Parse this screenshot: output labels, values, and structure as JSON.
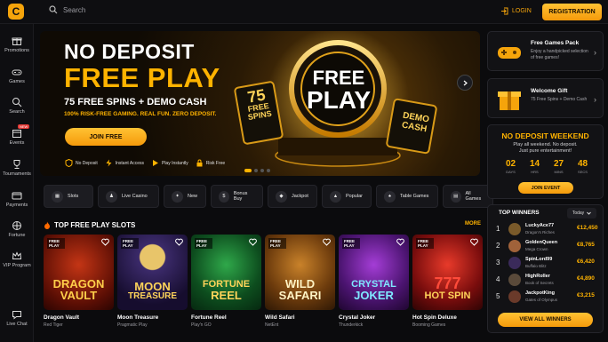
{
  "header": {
    "logo_glyph": "C",
    "search_placeholder": "Search",
    "login_label": "LOGIN",
    "register_label": "REGISTRATION",
    "accent": "#f5a40b"
  },
  "sidebar": {
    "items": [
      {
        "label": "Promotions",
        "icon": "gift-icon"
      },
      {
        "label": "Games",
        "icon": "gamepad-icon"
      },
      {
        "label": "Search",
        "icon": "search-icon"
      },
      {
        "label": "Events",
        "icon": "calendar-icon",
        "badge": "NEW"
      },
      {
        "label": "Tournaments",
        "icon": "trophy-icon"
      },
      {
        "label": "Payments",
        "icon": "card-icon"
      },
      {
        "label": "Fortune",
        "icon": "wheel-icon"
      },
      {
        "label": "VIP Program",
        "icon": "crown-icon"
      }
    ],
    "live_chat": "Live Chat"
  },
  "hero": {
    "title1": "NO DEPOSIT",
    "title2": "FREE PLAY",
    "subtitle": "75 FREE SPINS + DEMO CASH",
    "subtitle2": "100% RISK-FREE GAMING. REAL FUN. ZERO DEPOSIT.",
    "cta": "JOIN FREE",
    "chip_line1": "FREE",
    "chip_line2": "PLAY",
    "card_left_num": "75",
    "card_left_l1": "FREE",
    "card_left_l2": "SPINS",
    "card_right_l1": "DEMO",
    "card_right_l2": "CASH",
    "features": [
      {
        "label": "No Deposit",
        "icon": "shield-icon"
      },
      {
        "label": "Instant Access",
        "icon": "bolt-icon"
      },
      {
        "label": "Play Instantly",
        "icon": "play-icon"
      },
      {
        "label": "Risk Free",
        "icon": "lock-icon"
      }
    ]
  },
  "categories": [
    {
      "label": "Slots",
      "icon": "slot-icon",
      "active": true
    },
    {
      "label": "Live Casino",
      "icon": "dealer-icon"
    },
    {
      "label": "New",
      "icon": "new-icon"
    },
    {
      "label": "Bonus Buy",
      "icon": "bonus-icon"
    },
    {
      "label": "Jackpot",
      "icon": "diamond-icon"
    },
    {
      "label": "Popular",
      "icon": "flame-icon"
    },
    {
      "label": "Table Games",
      "icon": "cards-icon"
    },
    {
      "label": "All Games",
      "icon": "grid-icon"
    }
  ],
  "slots_section": {
    "title": "TOP FREE PLAY SLOTS",
    "more": "MORE",
    "badge_l1": "FREE",
    "badge_l2": "PLAY",
    "slots": [
      {
        "name": "Dragon Vault",
        "provider": "Red Tiger",
        "art1": "DRAGON",
        "art2": "VAULT"
      },
      {
        "name": "Moon Treasure",
        "provider": "Pragmatic Play",
        "art1": "MOON",
        "art2": "TREASURE"
      },
      {
        "name": "Fortune Reel",
        "provider": "Play'n GO",
        "art1": "FORTUNE",
        "art2": "REEL"
      },
      {
        "name": "Wild Safari",
        "provider": "NetEnt",
        "art1": "WILD",
        "art2": "SAFARI"
      },
      {
        "name": "Crystal Joker",
        "provider": "Thunderkick",
        "art1": "CRYSTAL",
        "art2": "JOKER"
      },
      {
        "name": "Hot Spin Deluxe",
        "provider": "Booming Games",
        "art1": "777",
        "art2": "HOT SPIN"
      }
    ]
  },
  "promos": [
    {
      "title": "Free Games Pack",
      "desc": "Enjoy a handpicked selection of free games!"
    },
    {
      "title": "Welcome Gift",
      "desc": "75 Free Spins + Demo Cash"
    }
  ],
  "event": {
    "title": "NO DEPOSIT WEEKEND",
    "desc1": "Play all weekend. No deposit.",
    "desc2": "Just pure entertainment!",
    "timer": [
      {
        "value": "02",
        "unit": "DAYS"
      },
      {
        "value": "14",
        "unit": "HRS"
      },
      {
        "value": "27",
        "unit": "MINS"
      },
      {
        "value": "48",
        "unit": "SECS"
      }
    ],
    "cta": "JOIN EVENT"
  },
  "winners": {
    "title": "TOP WINNERS",
    "period": "Today",
    "rows": [
      {
        "rank": "1",
        "name": "LuckyAce77",
        "game": "Dragon's Riches",
        "amount": "€12,450"
      },
      {
        "rank": "2",
        "name": "GoldenQueen",
        "game": "Mega Crown",
        "amount": "€8,765"
      },
      {
        "rank": "3",
        "name": "SpinLord99",
        "game": "Buffalo Blitz",
        "amount": "€6,420"
      },
      {
        "rank": "4",
        "name": "HighRoller",
        "game": "Book of Secrets",
        "amount": "€4,890"
      },
      {
        "rank": "5",
        "name": "JackpotKing",
        "game": "Gates of Olympus",
        "amount": "€3,215"
      }
    ],
    "cta": "VIEW ALL WINNERS"
  }
}
